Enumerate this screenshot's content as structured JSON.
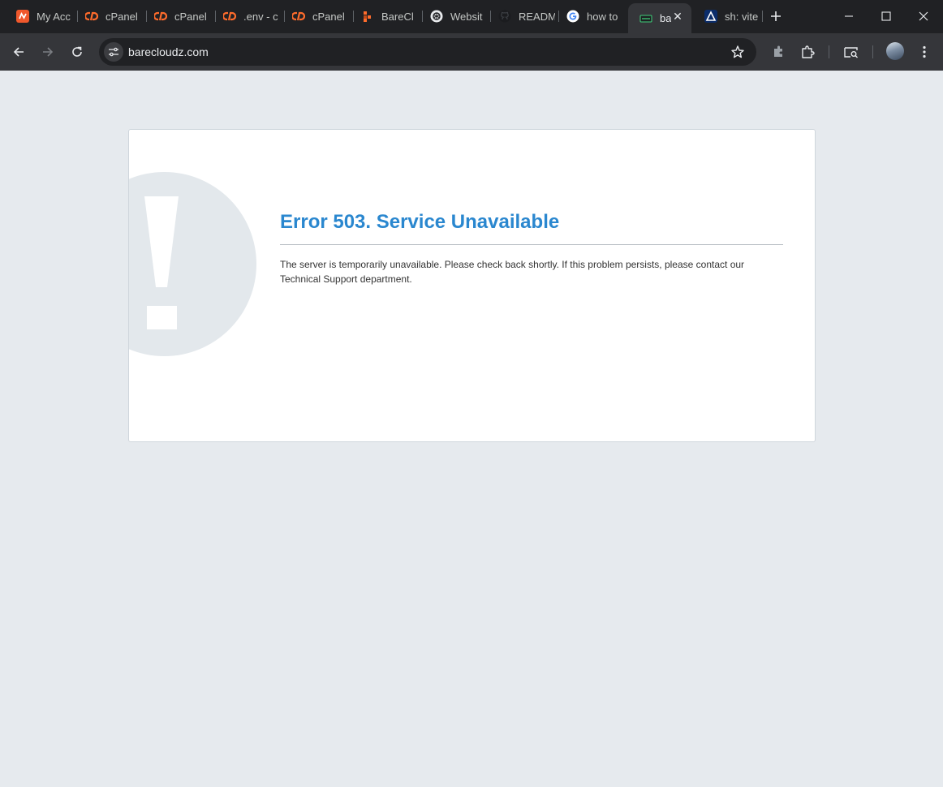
{
  "browser": {
    "tabs": [
      {
        "title": "My Acc",
        "icon": "brand-n-icon",
        "active": false
      },
      {
        "title": "cPanel",
        "icon": "cpanel-icon",
        "active": false
      },
      {
        "title": "cPanel",
        "icon": "cpanel-icon",
        "active": false
      },
      {
        "title": ".env - c",
        "icon": "cpanel-icon",
        "active": false
      },
      {
        "title": "cPanel",
        "icon": "cpanel-icon",
        "active": false
      },
      {
        "title": "BareCl",
        "icon": "barecloud-icon",
        "active": false
      },
      {
        "title": "Websit",
        "icon": "openai-icon",
        "active": false
      },
      {
        "title": "READM",
        "icon": "github-icon",
        "active": false
      },
      {
        "title": "how to",
        "icon": "google-icon",
        "active": false
      },
      {
        "title": "ba",
        "icon": "server-icon",
        "active": true
      },
      {
        "title": "sh: vite",
        "icon": "triangle-logo-icon",
        "active": false
      }
    ],
    "address": "barecloudz.com",
    "accent": "#35363a"
  },
  "page": {
    "title": "Error 503. Service Unavailable",
    "message": "The server is temporarily unavailable. Please check back shortly. If this problem persists, please contact our Technical Support department.",
    "title_color": "#2a87cf",
    "background": "#e6eaee"
  }
}
